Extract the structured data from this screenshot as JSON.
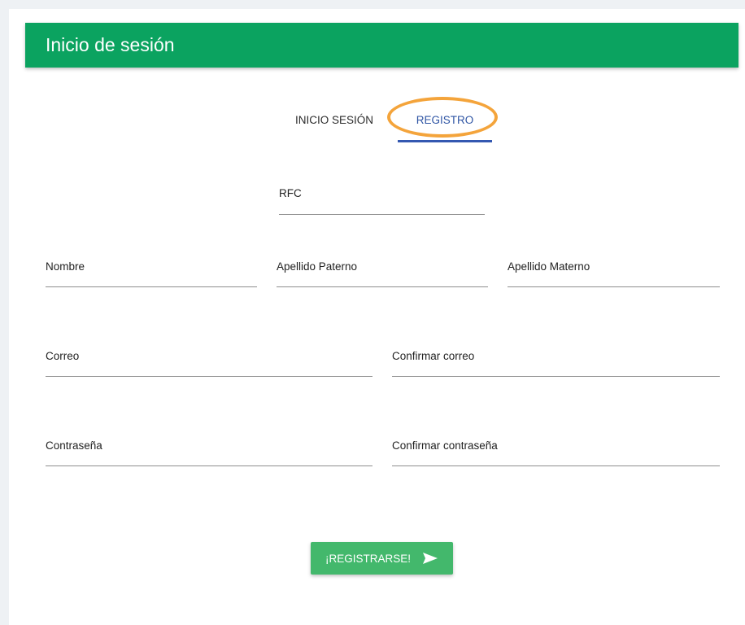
{
  "header": {
    "title": "Inicio de sesión"
  },
  "tabs": [
    {
      "label": "INICIO SESIÓN",
      "active": false
    },
    {
      "label": "REGISTRO",
      "active": true
    }
  ],
  "form": {
    "rfc": {
      "label": "RFC",
      "value": ""
    },
    "nombre": {
      "label": "Nombre",
      "value": ""
    },
    "apellido_paterno": {
      "label": "Apellido Paterno",
      "value": ""
    },
    "apellido_materno": {
      "label": "Apellido Materno",
      "value": ""
    },
    "correo": {
      "label": "Correo",
      "value": ""
    },
    "confirmar_correo": {
      "label": "Confirmar correo",
      "value": ""
    },
    "contrasena": {
      "label": "Contraseña",
      "value": ""
    },
    "confirmar_contrasena": {
      "label": "Confirmar contraseña",
      "value": ""
    }
  },
  "submit": {
    "label": "¡REGISTRARSE!",
    "icon": "send-icon"
  },
  "colors": {
    "header_bg": "#0ba360",
    "tab_active": "#2f55a4",
    "tab_underline": "#3458b1",
    "highlight_ring": "#f4a43b",
    "button_bg": "#43b86c"
  }
}
